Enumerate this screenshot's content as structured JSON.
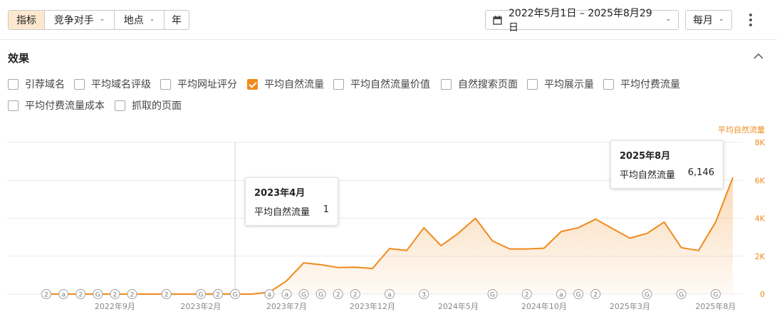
{
  "toolbar": {
    "metrics_label": "指标",
    "competitors_label": "竞争对手",
    "location_label": "地点",
    "year_label": "年",
    "date_range": "2022年5月1日 – 2025年8月29日",
    "interval_label": "每月"
  },
  "section": {
    "title": "效果"
  },
  "checkboxes": [
    {
      "label": "引荐域名",
      "checked": false
    },
    {
      "label": "平均域名评级",
      "checked": false
    },
    {
      "label": "平均网址评分",
      "checked": false
    },
    {
      "label": "平均自然流量",
      "checked": true
    },
    {
      "label": "平均自然流量价值",
      "checked": false
    },
    {
      "label": "自然搜索页面",
      "checked": false
    },
    {
      "label": "平均展示量",
      "checked": false
    },
    {
      "label": "平均付费流量",
      "checked": false
    },
    {
      "label": "平均付费流量成本",
      "checked": false
    },
    {
      "label": "抓取的页面",
      "checked": false
    }
  ],
  "colors": {
    "accent": "#f08a1c",
    "accent_light": "#fde8cf"
  },
  "chart_data": {
    "type": "area",
    "series": [
      {
        "name": "平均自然流量",
        "values": [
          0,
          0,
          0,
          0,
          0,
          0,
          0,
          0,
          0,
          0,
          0,
          0,
          1,
          100,
          700,
          1650,
          1550,
          1400,
          1420,
          1350,
          2400,
          2300,
          3500,
          2550,
          3200,
          4000,
          2800,
          2380,
          2380,
          2420,
          3300,
          3500,
          3950,
          3450,
          2950,
          3200,
          3800,
          2450,
          2300,
          3800,
          6146
        ]
      }
    ],
    "months": [
      "2022年5月",
      "2022年6月",
      "2022年7月",
      "2022年8月",
      "2022年9月",
      "2022年10月",
      "2022年11月",
      "2022年12月",
      "2023年1月",
      "2023年2月",
      "2023年3月",
      "2023年4月",
      "2023年5月",
      "2023年6月",
      "2023年7月",
      "2023年8月",
      "2023年9月",
      "2023年10月",
      "2023年11月",
      "2023年12月",
      "2024年1月",
      "2024年2月",
      "2024年3月",
      "2024年4月",
      "2024年5月",
      "2024年6月",
      "2024年7月",
      "2024年8月",
      "2024年9月",
      "2024年10月",
      "2024年11月",
      "2024年12月",
      "2025年1月",
      "2025年2月",
      "2025年3月",
      "2025年4月",
      "2025年5月",
      "2025年6月",
      "2025年7月",
      "2025年8月",
      "2025年9月"
    ],
    "x_tick_labels": [
      {
        "index": 4,
        "label": "2022年9月"
      },
      {
        "index": 9,
        "label": "2023年2月"
      },
      {
        "index": 14,
        "label": "2023年7月"
      },
      {
        "index": 19,
        "label": "2023年12月"
      },
      {
        "index": 24,
        "label": "2024年5月"
      },
      {
        "index": 29,
        "label": "2024年10月"
      },
      {
        "index": 34,
        "label": "2025年3月"
      },
      {
        "index": 39,
        "label": "2025年8月"
      }
    ],
    "y_ticks": [
      "0",
      "2K",
      "4K",
      "6K",
      "8K"
    ],
    "y_tick_values": [
      0,
      2000,
      4000,
      6000,
      8000
    ],
    "ylim": [
      0,
      8000
    ],
    "y_axis_title": "平均自然流量",
    "grid": true,
    "markers": [
      {
        "index": 0,
        "symbol": "2"
      },
      {
        "index": 1,
        "symbol": "a"
      },
      {
        "index": 2,
        "symbol": "2"
      },
      {
        "index": 3,
        "symbol": "G"
      },
      {
        "index": 4,
        "symbol": "2"
      },
      {
        "index": 5,
        "symbol": "2"
      },
      {
        "index": 7,
        "symbol": "2"
      },
      {
        "index": 9,
        "symbol": "G"
      },
      {
        "index": 10,
        "symbol": "2"
      },
      {
        "index": 11,
        "symbol": "G"
      },
      {
        "index": 13,
        "symbol": "a"
      },
      {
        "index": 14,
        "symbol": "a"
      },
      {
        "index": 15,
        "symbol": "G"
      },
      {
        "index": 16,
        "symbol": "G"
      },
      {
        "index": 17,
        "symbol": "2"
      },
      {
        "index": 18,
        "symbol": "2"
      },
      {
        "index": 20,
        "symbol": "a"
      },
      {
        "index": 22,
        "symbol": "3"
      },
      {
        "index": 26,
        "symbol": "G"
      },
      {
        "index": 28,
        "symbol": "2"
      },
      {
        "index": 30,
        "symbol": "a"
      },
      {
        "index": 31,
        "symbol": "G"
      },
      {
        "index": 32,
        "symbol": "2"
      },
      {
        "index": 35,
        "symbol": "G"
      },
      {
        "index": 37,
        "symbol": "G"
      },
      {
        "index": 39,
        "symbol": "G"
      }
    ],
    "tooltips": [
      {
        "title": "2023年4月",
        "series": "平均自然流量",
        "value": "1"
      },
      {
        "title": "2025年8月",
        "series": "平均自然流量",
        "value": "6,146"
      }
    ]
  }
}
